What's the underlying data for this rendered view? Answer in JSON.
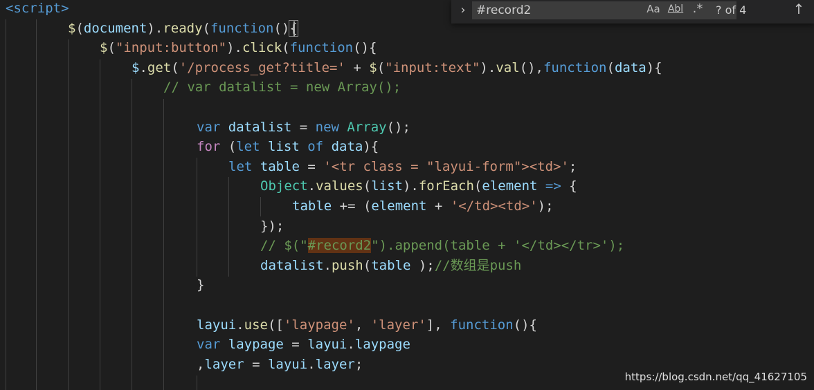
{
  "editor": {
    "lines": [
      [
        [
          "<script>",
          "t-tag"
        ]
      ],
      [
        [
          "$",
          "t-fn"
        ],
        [
          "(",
          "t-punc"
        ],
        [
          "document",
          "t-var"
        ],
        ").",
        "t-punc"
      ],
      [
        [
          "$",
          "t-fn"
        ],
        [
          "(",
          "t-punc"
        ],
        [
          "\"input:button\"",
          "t-str"
        ],
        [
          ").",
          "t-punc"
        ],
        [
          "click",
          "t-fn"
        ],
        [
          "(",
          "t-punc"
        ],
        [
          "function",
          "t-kw"
        ],
        [
          "(){",
          "t-punc"
        ]
      ],
      [
        [
          "$",
          "t-var"
        ],
        [
          ".",
          "t-punc"
        ],
        [
          "get",
          "t-fn"
        ],
        [
          "(",
          "t-punc"
        ],
        [
          "'/process_get?title='",
          "t-str"
        ],
        [
          " + ",
          "t-punc"
        ],
        [
          "$",
          "t-fn"
        ],
        [
          "(",
          "t-punc"
        ],
        [
          "\"input:text\"",
          "t-str"
        ],
        [
          ").",
          "t-punc"
        ],
        [
          "val",
          "t-fn"
        ],
        [
          "(),",
          "t-punc"
        ],
        [
          "function",
          "t-kw"
        ],
        [
          "(",
          "t-punc"
        ],
        [
          "data",
          "t-var"
        ],
        [
          "){",
          "t-punc"
        ]
      ],
      [
        [
          "// var datalist = new Array();",
          "t-com"
        ]
      ],
      [],
      [
        [
          "var",
          "t-kw"
        ],
        [
          " ",
          "t-punc"
        ],
        [
          "datalist",
          "t-var"
        ],
        [
          " = ",
          "t-punc"
        ],
        [
          "new",
          "t-kw"
        ],
        [
          " ",
          "t-punc"
        ],
        [
          "Array",
          "t-cls"
        ],
        [
          "();",
          "t-punc"
        ]
      ],
      [
        [
          "for",
          "t-ctrl"
        ],
        [
          " (",
          "t-punc"
        ],
        [
          "let",
          "t-kw"
        ],
        [
          " ",
          "t-punc"
        ],
        [
          "list",
          "t-var"
        ],
        [
          " ",
          "t-punc"
        ],
        [
          "of",
          "t-kw"
        ],
        [
          " ",
          "t-punc"
        ],
        [
          "data",
          "t-var"
        ],
        [
          "){",
          "t-punc"
        ]
      ],
      [
        [
          "let",
          "t-kw"
        ],
        [
          " ",
          "t-punc"
        ],
        [
          "table",
          "t-var"
        ],
        [
          " = ",
          "t-punc"
        ],
        [
          "'<tr class = \"layui-form\"><td>'",
          "t-str"
        ],
        [
          ";",
          "t-punc"
        ]
      ],
      [
        [
          "Object",
          "t-cls"
        ],
        [
          ".",
          "t-punc"
        ],
        [
          "values",
          "t-fn"
        ],
        [
          "(",
          "t-punc"
        ],
        [
          "list",
          "t-var"
        ],
        [
          ").",
          "t-punc"
        ],
        [
          "forEach",
          "t-fn"
        ],
        [
          "(",
          "t-punc"
        ],
        [
          "element",
          "t-var"
        ],
        [
          " ",
          "t-punc"
        ],
        [
          "=>",
          "t-kw"
        ],
        [
          " {",
          "t-punc"
        ]
      ],
      [
        [
          "table",
          "t-var"
        ],
        [
          " += (",
          "t-punc"
        ],
        [
          "element",
          "t-var"
        ],
        [
          " + ",
          "t-punc"
        ],
        [
          "'</td><td>'",
          "t-str"
        ],
        [
          ");",
          "t-punc"
        ]
      ],
      [
        [
          "});",
          "t-punc"
        ]
      ],
      [
        [
          "// $(\"",
          "t-com"
        ],
        [
          "#record2",
          "t-com t-hl"
        ],
        [
          "\").append(table + '</td></tr>');",
          "t-com"
        ]
      ],
      [
        [
          "datalist",
          "t-var"
        ],
        [
          ".",
          "t-punc"
        ],
        [
          "push",
          "t-fn"
        ],
        [
          "(",
          "t-punc"
        ],
        [
          "table",
          "t-var"
        ],
        [
          " );",
          "t-punc"
        ],
        [
          "//数组是push",
          "t-com"
        ]
      ],
      [
        [
          "}",
          "t-punc"
        ]
      ],
      [],
      [
        [
          "layui",
          "t-var"
        ],
        [
          ".",
          "t-punc"
        ],
        [
          "use",
          "t-fn"
        ],
        [
          "([",
          "t-punc"
        ],
        [
          "'laypage'",
          "t-str"
        ],
        [
          ", ",
          "t-punc"
        ],
        [
          "'layer'",
          "t-str"
        ],
        [
          "], ",
          "t-punc"
        ],
        [
          "function",
          "t-kw"
        ],
        [
          "(){",
          "t-punc"
        ]
      ],
      [
        [
          "var",
          "t-kw"
        ],
        [
          " ",
          "t-punc"
        ],
        [
          "laypage",
          "t-var"
        ],
        [
          " = ",
          "t-punc"
        ],
        [
          "layui",
          "t-var"
        ],
        [
          ".",
          "t-punc"
        ],
        [
          "laypage",
          "t-var"
        ]
      ],
      [
        [
          ",",
          "t-punc"
        ],
        [
          "layer",
          "t-var"
        ],
        [
          " = ",
          "t-punc"
        ],
        [
          "layui",
          "t-var"
        ],
        [
          ".",
          "t-punc"
        ],
        [
          "layer",
          "t-var"
        ],
        [
          ";",
          "t-punc"
        ]
      ]
    ],
    "line2_suffix": [
      [
        "ready",
        "t-fn"
      ],
      [
        "(",
        "t-punc"
      ],
      [
        "function",
        "t-kw"
      ],
      [
        "()",
        "t-punc"
      ],
      [
        "{",
        "t-punc t-brace"
      ]
    ]
  },
  "find": {
    "query": "#record2",
    "match_case_label": "Aa",
    "whole_word_label": "Abl",
    "regex_label": ".*",
    "count": "? of 4"
  },
  "watermark": "https://blog.csdn.net/qq_41627105"
}
